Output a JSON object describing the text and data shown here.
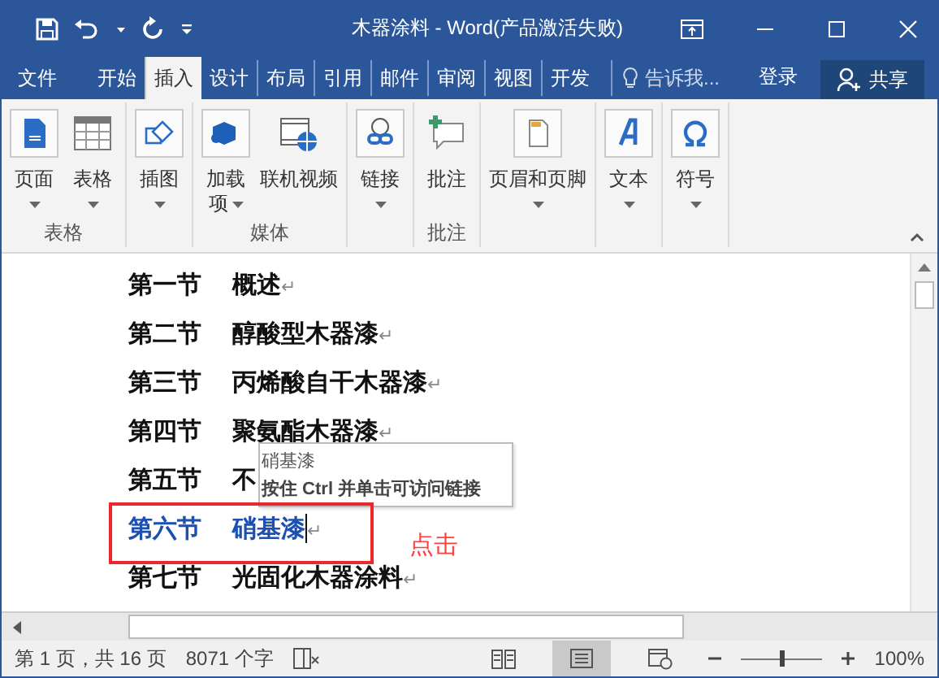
{
  "window": {
    "title": "木器涂料 - Word(产品激活失败)"
  },
  "tabs": [
    {
      "label": "文件",
      "selected": false
    },
    {
      "label": "开始",
      "selected": false
    },
    {
      "label": "插入",
      "selected": true
    },
    {
      "label": "设计",
      "selected": false
    },
    {
      "label": "布局",
      "selected": false
    },
    {
      "label": "引用",
      "selected": false
    },
    {
      "label": "邮件",
      "selected": false
    },
    {
      "label": "审阅",
      "selected": false
    },
    {
      "label": "视图",
      "selected": false
    },
    {
      "label": "开发",
      "selected": false
    }
  ],
  "tell_me": {
    "placeholder": "告诉我..."
  },
  "sign_in": "登录",
  "share": "共享",
  "ribbon": {
    "groups": [
      {
        "label": "表格",
        "buttons": [
          {
            "label": "页面",
            "kind": "page",
            "dropdown": true,
            "wrap": false
          },
          {
            "label": "表格",
            "kind": "table",
            "dropdown": true,
            "wrap": false
          }
        ]
      },
      {
        "buttons": [
          {
            "label": "插图",
            "kind": "shapes",
            "dropdown": true,
            "wrap": false
          }
        ]
      },
      {
        "label": "媒体",
        "buttons": [
          {
            "label": "加载项",
            "kind": "addin",
            "dropdown": true,
            "wrap": true
          },
          {
            "label": "联机视频",
            "kind": "video",
            "dropdown": false,
            "wrap": false
          }
        ]
      },
      {
        "buttons": [
          {
            "label": "链接",
            "kind": "link",
            "dropdown": true,
            "wrap": false
          }
        ]
      },
      {
        "label": "批注",
        "buttons": [
          {
            "label": "批注",
            "kind": "comment",
            "dropdown": false,
            "wrap": false
          }
        ]
      },
      {
        "buttons": [
          {
            "label": "页眉和页脚",
            "kind": "header",
            "dropdown": true,
            "wrap": false
          }
        ]
      },
      {
        "buttons": [
          {
            "label": "文本",
            "kind": "text",
            "dropdown": true,
            "wrap": false
          }
        ]
      },
      {
        "buttons": [
          {
            "label": "符号",
            "kind": "symbol",
            "dropdown": true,
            "wrap": false
          }
        ]
      }
    ]
  },
  "document": {
    "lines": [
      {
        "number": "第一节",
        "title": "概述",
        "pilcrow": "↵",
        "kind": "plain",
        "cursor": false
      },
      {
        "number": "第二节",
        "title": "醇酸型木器漆",
        "pilcrow": "↵",
        "kind": "plain",
        "cursor": false
      },
      {
        "number": "第三节",
        "title": "丙烯酸自干木器漆",
        "pilcrow": "↵",
        "kind": "plain",
        "cursor": false
      },
      {
        "number": "第四节",
        "title": "聚氨酯木器漆",
        "pilcrow": "↵",
        "kind": "plain",
        "cursor": false
      },
      {
        "number": "第五节",
        "title": "不",
        "kind": "plain",
        "cursor": false
      },
      {
        "number": "第六节",
        "title": "硝基漆",
        "pilcrow": "↵",
        "kind": "link",
        "cursor": true
      },
      {
        "number": "第七节",
        "title": "光固化木器涂料",
        "pilcrow": "↵",
        "kind": "plain",
        "cursor": false
      }
    ]
  },
  "tooltip": {
    "title": "硝基漆",
    "hint": "按住 Ctrl 并单击可访问链接"
  },
  "annotation": {
    "label": "点击"
  },
  "status_bar": {
    "page": "第 1 页，共 16 页",
    "words": "8071 个字",
    "views": [
      {
        "selected": false
      },
      {
        "selected": true
      },
      {
        "selected": false
      }
    ],
    "zoom_slider": {
      "level": 0.5
    },
    "zoom": "100%"
  }
}
